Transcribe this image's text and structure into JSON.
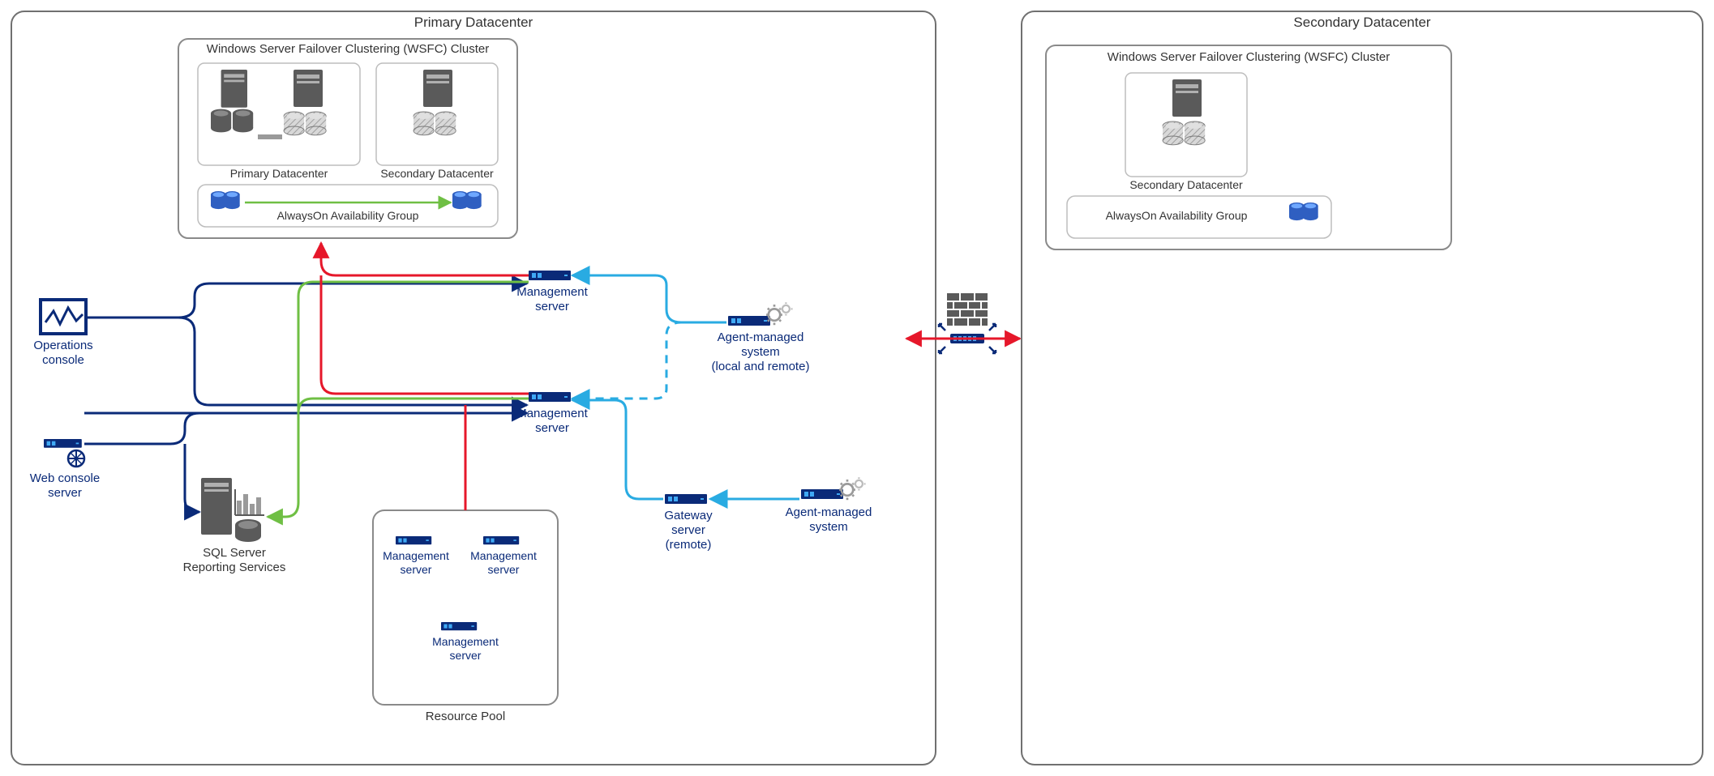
{
  "primary": {
    "title": "Primary Datacenter",
    "wsfc": {
      "title": "Windows Server Failover Clustering (WSFC) Cluster",
      "primary_label": "Primary Datacenter",
      "secondary_label": "Secondary Datacenter",
      "aoag": "AlwaysOn Availability Group"
    },
    "operations_console": "Operations\nconsole",
    "web_console": "Web console\nserver",
    "sql_reporting": "SQL Server\nReporting Services",
    "mgmt_server_1": "Management\nserver",
    "mgmt_server_2": "Management\nserver",
    "agent_local_remote": "Agent-managed\nsystem\n(local and remote)",
    "gateway_remote": "Gateway\nserver\n(remote)",
    "agent_managed": "Agent-managed\nsystem",
    "resource_pool": {
      "title": "Resource Pool",
      "ms1": "Management\nserver",
      "ms2": "Management\nserver",
      "ms3": "Management\nserver"
    }
  },
  "secondary": {
    "title": "Secondary Datacenter",
    "wsfc": {
      "title": "Windows Server Failover Clustering (WSFC) Cluster",
      "secondary_label": "Secondary Datacenter",
      "aoag": "AlwaysOn Availability Group"
    }
  },
  "colors": {
    "blue_dark": "#0a2a78",
    "blue_light": "#29abe2",
    "red": "#e6172a",
    "green": "#6fbf44",
    "gray": "#707070"
  }
}
